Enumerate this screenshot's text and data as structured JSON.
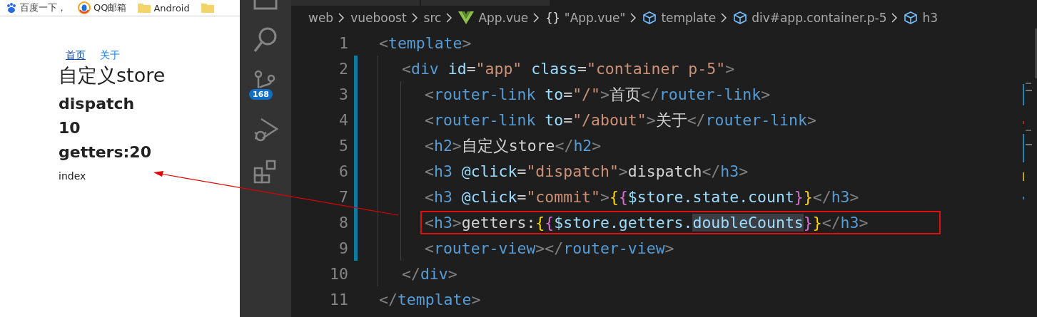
{
  "browser": {
    "bookmarks": [
      {
        "kind": "site",
        "label": "百度一下，"
      },
      {
        "kind": "site",
        "label": "QQ邮箱"
      },
      {
        "kind": "folder",
        "label": "Android"
      },
      {
        "kind": "folder"
      }
    ],
    "nav_links": [
      {
        "label": "首页",
        "selected": true
      },
      {
        "label": "关于",
        "selected": false
      }
    ],
    "heading": "自定义store",
    "lines": [
      "dispatch",
      "10",
      "getters:20"
    ],
    "view_text": "index"
  },
  "editor": {
    "source_control_badge": "168",
    "breadcrumb": [
      {
        "kind": "folder",
        "label": "web"
      },
      {
        "kind": "folder",
        "label": "vueboost"
      },
      {
        "kind": "folder",
        "label": "src"
      },
      {
        "kind": "file",
        "label": "App.vue"
      },
      {
        "kind": "module",
        "symbol": "{}",
        "label": "\"App.vue\""
      },
      {
        "kind": "element",
        "label": "template"
      },
      {
        "kind": "element",
        "label": "div#app.container.p-5"
      },
      {
        "kind": "element",
        "label": "h3"
      }
    ],
    "lines": [
      {
        "number": "1",
        "modified": false,
        "boxed": false,
        "tokens": [
          {
            "kind": "punct",
            "text": "<"
          },
          {
            "kind": "tag",
            "text": "template"
          },
          {
            "kind": "punct",
            "text": ">"
          }
        ],
        "children": [
          {
            "number": "2",
            "modified": true,
            "boxed": false,
            "tokens": [
              {
                "kind": "punct",
                "text": "<"
              },
              {
                "kind": "tag",
                "text": "div"
              },
              {
                "kind": "attr",
                "text": " id"
              },
              {
                "kind": "plain",
                "text": "="
              },
              {
                "kind": "string",
                "text": "\"app\""
              },
              {
                "kind": "attr",
                "text": " class"
              },
              {
                "kind": "plain",
                "text": "="
              },
              {
                "kind": "string",
                "text": "\"container p-5\""
              },
              {
                "kind": "punct",
                "text": ">"
              }
            ],
            "children": [
              {
                "number": "3",
                "modified": true,
                "boxed": false,
                "tokens": [
                  {
                    "kind": "punct",
                    "text": "<"
                  },
                  {
                    "kind": "tag",
                    "text": "router-link"
                  },
                  {
                    "kind": "attr",
                    "text": " to"
                  },
                  {
                    "kind": "plain",
                    "text": "="
                  },
                  {
                    "kind": "string",
                    "text": "\"/\""
                  },
                  {
                    "kind": "punct",
                    "text": ">"
                  },
                  {
                    "kind": "plain",
                    "text": "首页"
                  },
                  {
                    "kind": "punct",
                    "text": "</"
                  },
                  {
                    "kind": "tag",
                    "text": "router-link"
                  },
                  {
                    "kind": "punct",
                    "text": ">"
                  }
                ]
              },
              {
                "number": "4",
                "modified": true,
                "boxed": false,
                "tokens": [
                  {
                    "kind": "punct",
                    "text": "<"
                  },
                  {
                    "kind": "tag",
                    "text": "router-link"
                  },
                  {
                    "kind": "attr",
                    "text": " to"
                  },
                  {
                    "kind": "plain",
                    "text": "="
                  },
                  {
                    "kind": "string",
                    "text": "\"/about\""
                  },
                  {
                    "kind": "punct",
                    "text": ">"
                  },
                  {
                    "kind": "plain",
                    "text": "关于"
                  },
                  {
                    "kind": "punct",
                    "text": "</"
                  },
                  {
                    "kind": "tag",
                    "text": "router-link"
                  },
                  {
                    "kind": "punct",
                    "text": ">"
                  }
                ]
              },
              {
                "number": "5",
                "modified": true,
                "boxed": false,
                "tokens": [
                  {
                    "kind": "punct",
                    "text": "<"
                  },
                  {
                    "kind": "tag",
                    "text": "h2"
                  },
                  {
                    "kind": "punct",
                    "text": ">"
                  },
                  {
                    "kind": "plain",
                    "text": "自定义store"
                  },
                  {
                    "kind": "punct",
                    "text": "</"
                  },
                  {
                    "kind": "tag",
                    "text": "h2"
                  },
                  {
                    "kind": "punct",
                    "text": ">"
                  }
                ]
              },
              {
                "number": "6",
                "modified": true,
                "boxed": false,
                "tokens": [
                  {
                    "kind": "punct",
                    "text": "<"
                  },
                  {
                    "kind": "tag",
                    "text": "h3"
                  },
                  {
                    "kind": "attr",
                    "text": " @click"
                  },
                  {
                    "kind": "plain",
                    "text": "="
                  },
                  {
                    "kind": "string",
                    "text": "\"dispatch\""
                  },
                  {
                    "kind": "punct",
                    "text": ">"
                  },
                  {
                    "kind": "plain",
                    "text": "dispatch"
                  },
                  {
                    "kind": "punct",
                    "text": "</"
                  },
                  {
                    "kind": "tag",
                    "text": "h3"
                  },
                  {
                    "kind": "punct",
                    "text": ">"
                  }
                ]
              },
              {
                "number": "7",
                "modified": true,
                "boxed": false,
                "tokens": [
                  {
                    "kind": "punct",
                    "text": "<"
                  },
                  {
                    "kind": "tag",
                    "text": "h3"
                  },
                  {
                    "kind": "attr",
                    "text": " @click"
                  },
                  {
                    "kind": "plain",
                    "text": "="
                  },
                  {
                    "kind": "string",
                    "text": "\"commit\""
                  },
                  {
                    "kind": "punct",
                    "text": ">"
                  },
                  {
                    "kind": "brace",
                    "text": "{"
                  },
                  {
                    "kind": "brace2",
                    "text": "{"
                  },
                  {
                    "kind": "attr",
                    "text": "$store.state.count"
                  },
                  {
                    "kind": "brace2",
                    "text": "}"
                  },
                  {
                    "kind": "brace",
                    "text": "}"
                  },
                  {
                    "kind": "punct",
                    "text": "</"
                  },
                  {
                    "kind": "tag",
                    "text": "h3"
                  },
                  {
                    "kind": "punct",
                    "text": ">"
                  }
                ]
              },
              {
                "number": "8",
                "modified": true,
                "boxed": true,
                "tokens": [
                  {
                    "kind": "punct",
                    "text": "<"
                  },
                  {
                    "kind": "tag",
                    "text": "h3"
                  },
                  {
                    "kind": "punct",
                    "text": ">"
                  },
                  {
                    "kind": "plain",
                    "text": "getters:"
                  },
                  {
                    "kind": "brace",
                    "text": "{"
                  },
                  {
                    "kind": "brace2",
                    "text": "{"
                  },
                  {
                    "kind": "attr",
                    "text": "$store.getters."
                  },
                  {
                    "kind": "selection",
                    "text": "doubleCounts"
                  },
                  {
                    "kind": "brace2",
                    "text": "}"
                  },
                  {
                    "kind": "brace",
                    "text": "}"
                  },
                  {
                    "kind": "punct",
                    "text": "</"
                  },
                  {
                    "kind": "tag",
                    "text": "h3"
                  },
                  {
                    "kind": "punct",
                    "text": ">"
                  }
                ]
              },
              {
                "number": "9",
                "modified": true,
                "boxed": false,
                "tokens": [
                  {
                    "kind": "punct",
                    "text": "<"
                  },
                  {
                    "kind": "tag",
                    "text": "router-view"
                  },
                  {
                    "kind": "punct",
                    "text": "></"
                  },
                  {
                    "kind": "tag",
                    "text": "router-view"
                  },
                  {
                    "kind": "punct",
                    "text": ">"
                  }
                ]
              }
            ]
          },
          {
            "number": "10",
            "modified": false,
            "boxed": false,
            "tokens": [
              {
                "kind": "punct",
                "text": "</"
              },
              {
                "kind": "tag",
                "text": "div"
              },
              {
                "kind": "punct",
                "text": ">"
              }
            ]
          }
        ]
      },
      {
        "number": "11",
        "modified": false,
        "boxed": false,
        "tokens": [
          {
            "kind": "punct",
            "text": "</"
          },
          {
            "kind": "tag",
            "text": "template"
          },
          {
            "kind": "punct",
            "text": ">"
          }
        ]
      }
    ]
  }
}
